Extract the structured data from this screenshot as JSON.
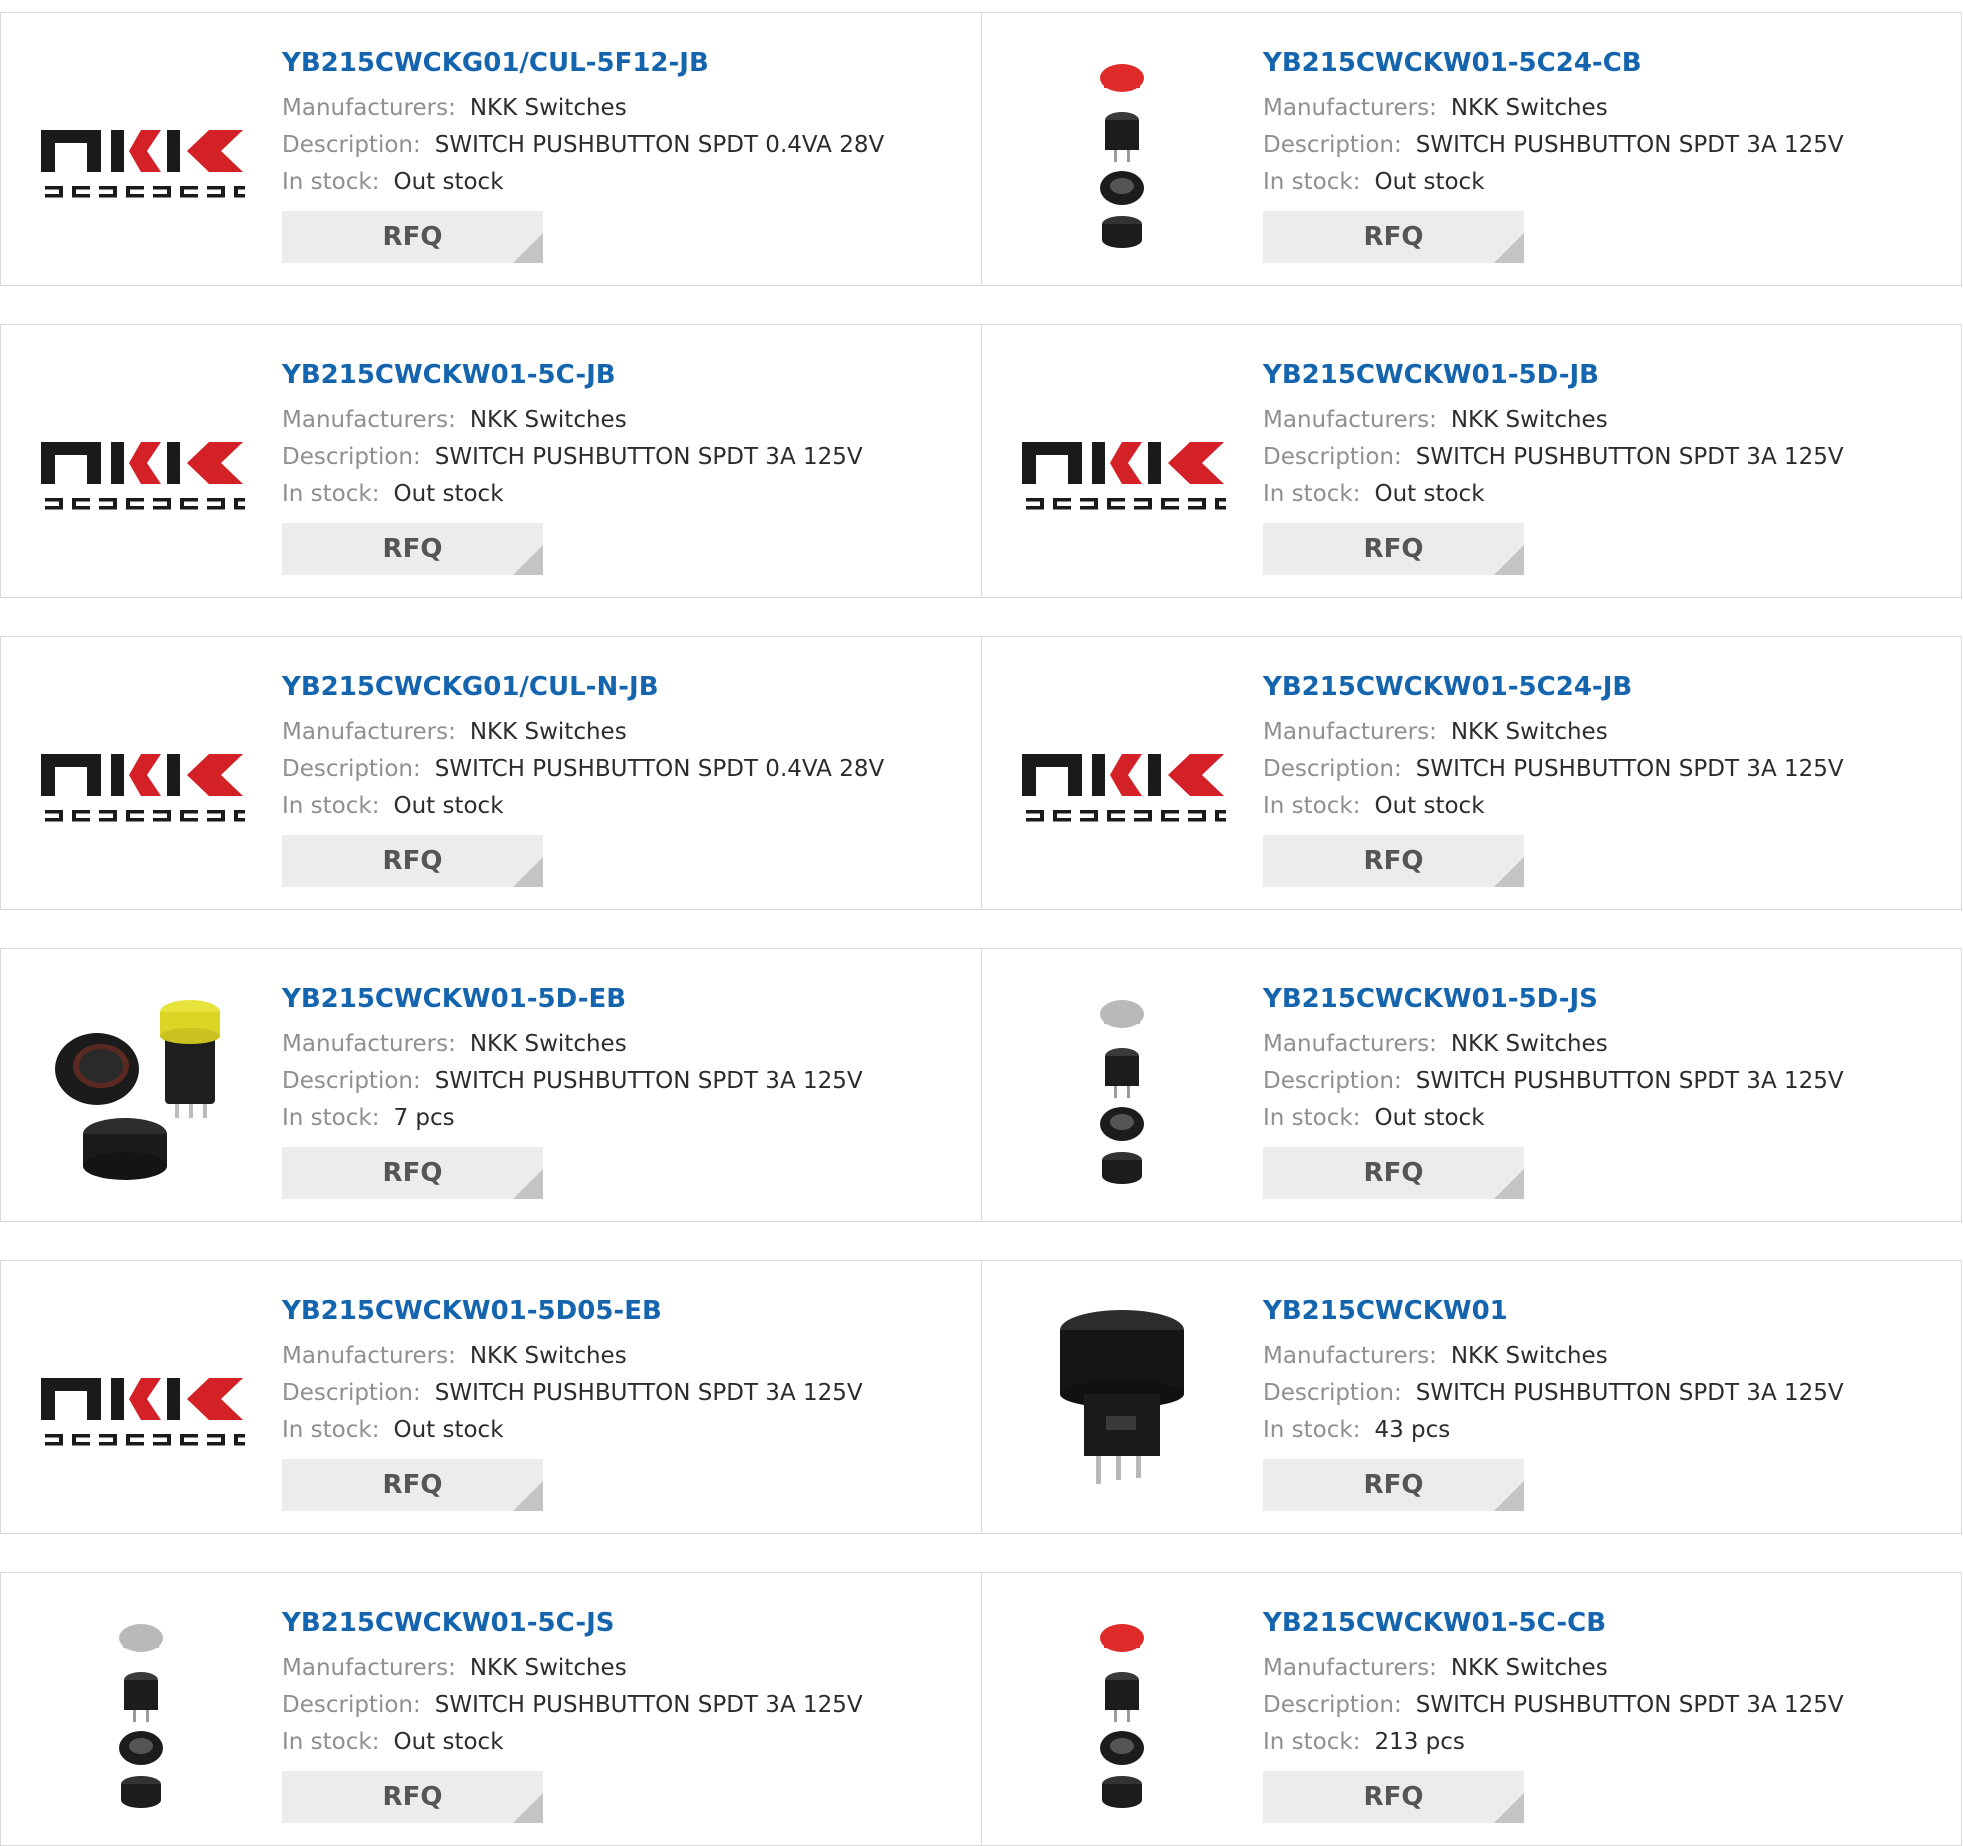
{
  "labels": {
    "manufacturers": "Manufacturers:",
    "description": "Description:",
    "in_stock": "In stock:",
    "rfq": "RFQ"
  },
  "logo": {
    "mark": "NKK",
    "sub": "SWITCHES",
    "color": "#d42027"
  },
  "colors": {
    "title": "#1565ae",
    "border": "#d9d9d9",
    "button_bg": "#ececec",
    "button_corner": "#c4c4c4"
  },
  "products": [
    {
      "part": "YB215CWCKG01/CUL-5F12-JB",
      "manufacturer": "NKK Switches",
      "description": "SWITCH PUSHBUTTON SPDT 0.4VA 28V",
      "stock": "Out stock",
      "image": "nkk-logo"
    },
    {
      "part": "YB215CWCKW01-5C24-CB",
      "manufacturer": "NKK Switches",
      "description": "SWITCH PUSHBUTTON SPDT 3A 125V",
      "stock": "Out stock",
      "image": "exploded-red"
    },
    {
      "part": "YB215CWCKW01-5C-JB",
      "manufacturer": "NKK Switches",
      "description": "SWITCH PUSHBUTTON SPDT 3A 125V",
      "stock": "Out stock",
      "image": "nkk-logo"
    },
    {
      "part": "YB215CWCKW01-5D-JB",
      "manufacturer": "NKK Switches",
      "description": "SWITCH PUSHBUTTON SPDT 3A 125V",
      "stock": "Out stock",
      "image": "nkk-logo"
    },
    {
      "part": "YB215CWCKG01/CUL-N-JB",
      "manufacturer": "NKK Switches",
      "description": "SWITCH PUSHBUTTON SPDT 0.4VA 28V",
      "stock": "Out stock",
      "image": "nkk-logo"
    },
    {
      "part": "YB215CWCKW01-5C24-JB",
      "manufacturer": "NKK Switches",
      "description": "SWITCH PUSHBUTTON SPDT 3A 125V",
      "stock": "Out stock",
      "image": "nkk-logo"
    },
    {
      "part": "YB215CWCKW01-5D-EB",
      "manufacturer": "NKK Switches",
      "description": "SWITCH PUSHBUTTON SPDT 3A 125V",
      "stock": "7 pcs",
      "image": "yellow-button"
    },
    {
      "part": "YB215CWCKW01-5D-JS",
      "manufacturer": "NKK Switches",
      "description": "SWITCH PUSHBUTTON SPDT 3A 125V",
      "stock": "Out stock",
      "image": "exploded-gray"
    },
    {
      "part": "YB215CWCKW01-5D05-EB",
      "manufacturer": "NKK Switches",
      "description": "SWITCH PUSHBUTTON SPDT 3A 125V",
      "stock": "Out stock",
      "image": "nkk-logo"
    },
    {
      "part": "YB215CWCKW01",
      "manufacturer": "NKK Switches",
      "description": "SWITCH PUSHBUTTON SPDT 3A 125V",
      "stock": "43 pcs",
      "image": "black-body"
    },
    {
      "part": "YB215CWCKW01-5C-JS",
      "manufacturer": "NKK Switches",
      "description": "SWITCH PUSHBUTTON SPDT 3A 125V",
      "stock": "Out stock",
      "image": "exploded-gray"
    },
    {
      "part": "YB215CWCKW01-5C-CB",
      "manufacturer": "NKK Switches",
      "description": "SWITCH PUSHBUTTON SPDT 3A 125V",
      "stock": "213 pcs",
      "image": "exploded-red"
    }
  ]
}
